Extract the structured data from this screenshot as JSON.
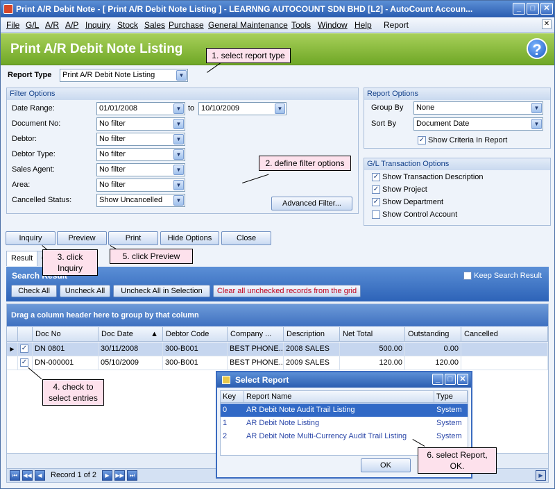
{
  "window": {
    "title": "Print A/R Debit Note - [ Print A/R Debit Note Listing ] - LEARNNG AUTOCOUNT SDN BHD [L2] - AutoCount Accoun..."
  },
  "menu": [
    "File",
    "G/L",
    "A/R",
    "A/P",
    "Inquiry",
    "Stock",
    "Sales",
    "Purchase",
    "General Maintenance",
    "Tools",
    "Window",
    "Help",
    "Report"
  ],
  "header": {
    "title": "Print A/R Debit Note Listing",
    "help": "?"
  },
  "report_type": {
    "label": "Report Type",
    "value": "Print A/R Debit Note Listing"
  },
  "filter": {
    "title": "Filter Options",
    "date_range": {
      "label": "Date Range:",
      "from": "01/01/2008",
      "to_label": "to",
      "to": "10/10/2009"
    },
    "rows": [
      {
        "label": "Document No:",
        "value": "No filter"
      },
      {
        "label": "Debtor:",
        "value": "No filter"
      },
      {
        "label": "Debtor Type:",
        "value": "No filter"
      },
      {
        "label": "Sales Agent:",
        "value": "No filter"
      },
      {
        "label": "Area:",
        "value": "No filter"
      },
      {
        "label": "Cancelled Status:",
        "value": "Show Uncancelled"
      }
    ],
    "advanced": "Advanced Filter..."
  },
  "report_options": {
    "title": "Report Options",
    "group_by": {
      "label": "Group By",
      "value": "None"
    },
    "sort_by": {
      "label": "Sort By",
      "value": "Document Date"
    },
    "show_criteria": "Show Criteria In Report"
  },
  "gl_options": {
    "title": "G/L Transaction Options",
    "items": [
      {
        "label": "Show Transaction Description",
        "checked": true
      },
      {
        "label": "Show Project",
        "checked": true
      },
      {
        "label": "Show Department",
        "checked": true
      },
      {
        "label": "Show Control Account",
        "checked": false
      }
    ]
  },
  "actions": [
    "Inquiry",
    "Preview",
    "Print",
    "Hide Options",
    "Close"
  ],
  "tabs": [
    "Result",
    "C"
  ],
  "search": {
    "title": "Search Result",
    "keep": "Keep Search Result",
    "buttons": [
      "Check All",
      "Uncheck All",
      "Uncheck All in Selection",
      "Clear all unchecked records from the grid"
    ]
  },
  "grid": {
    "group_hint": "Drag a column header here to group by that column",
    "columns": [
      "Doc No",
      "Doc Date",
      "Debtor Code",
      "Company ...",
      "Description",
      "Net Total",
      "Outstanding",
      "Cancelled"
    ],
    "rows": [
      [
        "DN 0801",
        "30/11/2008",
        "300-B001",
        "BEST PHONE...",
        "2008 SALES",
        "500.00",
        "0.00",
        ""
      ],
      [
        "DN-000001",
        "05/10/2009",
        "300-B001",
        "BEST PHONE...",
        "2009 SALES",
        "120.00",
        "120.00",
        ""
      ]
    ],
    "record": "Record 1 of 2"
  },
  "dialog": {
    "title": "Select Report",
    "columns": [
      "Key",
      "Report Name",
      "Type"
    ],
    "rows": [
      [
        "0",
        "AR Debit Note Audit Trail Listing",
        "System"
      ],
      [
        "1",
        "AR Debit Note Listing",
        "System"
      ],
      [
        "2",
        "AR Debit Note Multi-Currency Audit Trail Listing",
        "System"
      ]
    ],
    "ok": "OK"
  },
  "callouts": {
    "c1": "1. select report type",
    "c2": "2. define filter options",
    "c3": "3. click Inquiry",
    "c4": "4. check to select entries",
    "c5": "5. click Preview",
    "c6": "6. select Report, OK."
  },
  "colors": {
    "accent": "#2a5cb0",
    "header_green": "#6fa726",
    "callout": "#fde1ec"
  }
}
